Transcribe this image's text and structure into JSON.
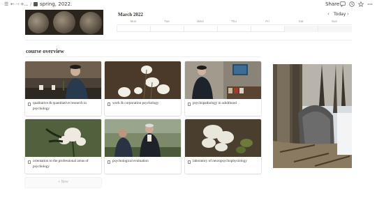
{
  "topbar": {
    "breadcrumb_ellipsis": "...",
    "breadcrumb_separator": "/",
    "page_title": "spring, 2022.",
    "share_label": "Share"
  },
  "calendar": {
    "title": "March 2022",
    "today_label": "Today",
    "prev_icon": "‹",
    "next_icon": "›",
    "weekdays": [
      "Mon",
      "Tue",
      "Wed",
      "Thu",
      "Fri",
      "Sat",
      "Sun"
    ]
  },
  "section": {
    "title": "course overview"
  },
  "cards": [
    {
      "label": "qualitative & quantitative research in psychology",
      "image": "elderly-man-with-glasses-and-wine"
    },
    {
      "label": "work & corporation psychology",
      "image": "white-flowers-dark-background"
    },
    {
      "label": "psychopathology in adulthood",
      "image": "man-in-study-with-tv"
    },
    {
      "label": "orientation to the professional areas of psychology",
      "image": "white-bouquet-green-background"
    },
    {
      "label": "psychological evaluation",
      "image": "two-men-outdoors"
    },
    {
      "label": "laboratory of neuropsychophysiology",
      "image": "white-lilac-flowers"
    }
  ],
  "new_label": "+ New",
  "icons": {
    "sidebar": "sidebar-icon",
    "back": "arrow-left-icon",
    "forward": "arrow-right-icon",
    "add": "plus-icon",
    "page": "page-icon",
    "comment": "comment-icon",
    "history": "clock-icon",
    "favorite": "star-icon",
    "more": "more-icon",
    "document": "document-icon"
  },
  "colors": {
    "text": "#37352f",
    "muted": "#9b9a97",
    "border": "#ececec"
  }
}
